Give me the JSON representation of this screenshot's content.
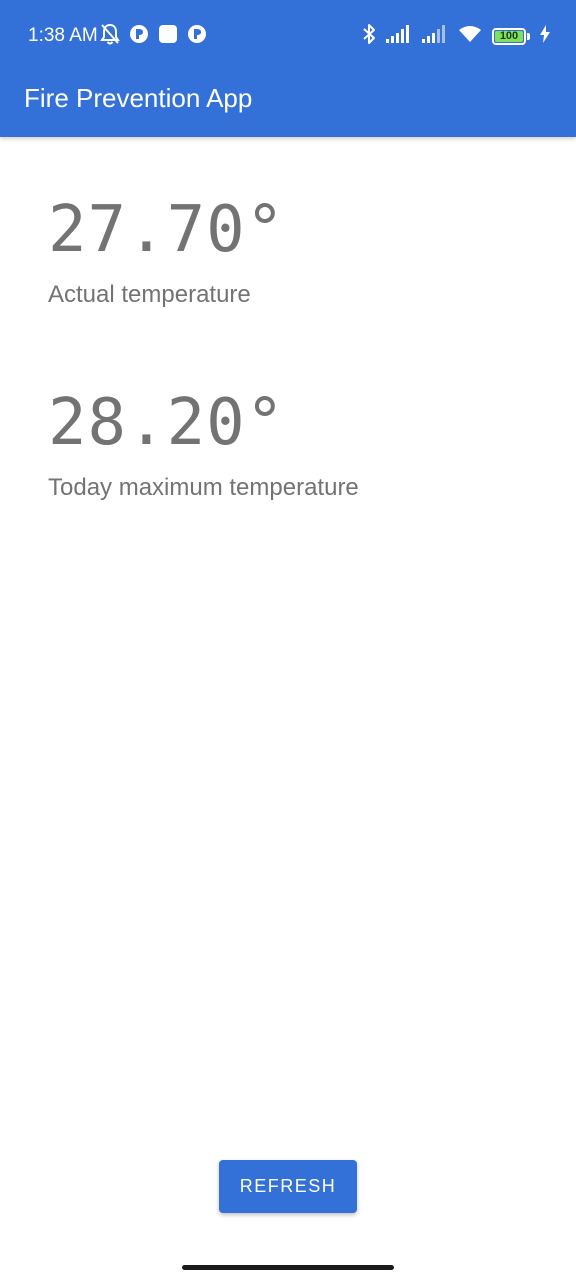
{
  "status_bar": {
    "time": "1:38 AM",
    "battery_level": "100",
    "battery_fraction": 1.0,
    "icons_left": [
      "notifications-muted-icon",
      "app-notification-icon",
      "app-notification-square-icon",
      "app-notification-icon"
    ],
    "icons_right": [
      "bluetooth-icon",
      "signal-icon",
      "signal-icon",
      "wifi-icon",
      "battery-icon",
      "charging-icon"
    ]
  },
  "app_bar": {
    "title": "Fire Prevention App"
  },
  "readings": {
    "actual": {
      "value": "27.70°",
      "label": "Actual temperature"
    },
    "max_today": {
      "value": "28.20°",
      "label": "Today maximum temperature"
    }
  },
  "actions": {
    "refresh_label": "REFRESH"
  },
  "colors": {
    "primary": "#3371d9",
    "text_secondary": "#737373",
    "battery_fill": "#7fe05b"
  }
}
